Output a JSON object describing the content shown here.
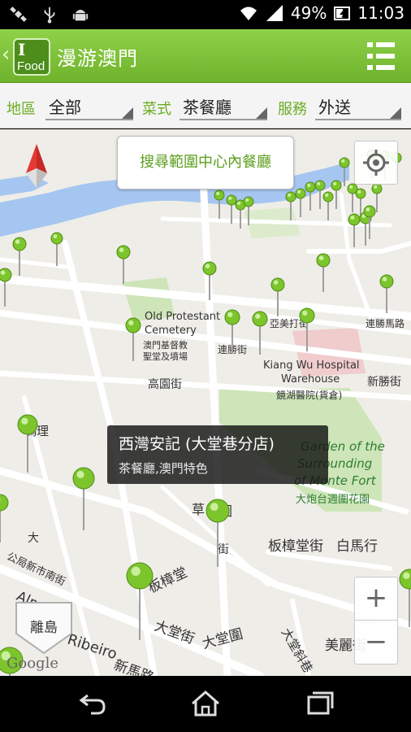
{
  "status_bar": {
    "battery": "49%",
    "time": "11:03",
    "left_icons": [
      "satellite-icon",
      "usb-icon",
      "android-icon"
    ],
    "right_icons": [
      "wifi-icon",
      "signal-icon",
      "battery-charging-icon"
    ]
  },
  "app_bar": {
    "logo_line1": "I",
    "logo_line2": "Food",
    "title": "漫游澳門",
    "back_icon": "chevron-left-icon",
    "menu_icon": "list-menu-icon"
  },
  "filters": {
    "region": {
      "label": "地區",
      "value": "全部"
    },
    "cuisine": {
      "label": "菜式",
      "value": "茶餐廳"
    },
    "service": {
      "label": "服務",
      "value": "外送"
    }
  },
  "map": {
    "search_button": "搜尋範圍中心內餐廳",
    "info_window": {
      "name": "西灣安記 (大堂巷分店)",
      "category": "茶餐廳,澳門特色"
    },
    "zoom_in": "+",
    "zoom_out": "−",
    "island_button": "離島",
    "attribution": "Google",
    "labels": {
      "cemetery_en1": "Old Protestant",
      "cemetery_en2": "Cemetery",
      "cemetery_zh1": "澳門基督教",
      "cemetery_zh2": "聖堂及墳場",
      "hospital_en1": "Kiang Wu Hospital",
      "hospital_en2": "Warehouse",
      "hospital_zh": "鏡湖醫院(貨倉)",
      "fort_en1": "Garden of the",
      "fort_en2": "Surrounding",
      "fort_en3": "of Monte Fort",
      "fort_zh": "大炮台週圍花園",
      "street1": "高園街",
      "street2": "板樟堂街",
      "street3": "白馬行",
      "street4": "大堂街",
      "street5": "大堂圍",
      "street6": "美麗街",
      "street7": "新勝街",
      "street8": "連勝馬路",
      "street9": "亞美打街",
      "street10": "連勝街",
      "street11": "草",
      "street12": "圍",
      "street13": "板樟堂",
      "street14": "大堂斜巷",
      "street15": "新馬路",
      "street16": "公局新市南街",
      "street17": "大",
      "street18": "瑪理",
      "street19": "Ribeiro",
      "street20": "Almeida",
      "street21": "街"
    }
  },
  "nav_bar": {
    "icons": [
      "back-icon",
      "home-icon",
      "recent-apps-icon"
    ]
  }
}
